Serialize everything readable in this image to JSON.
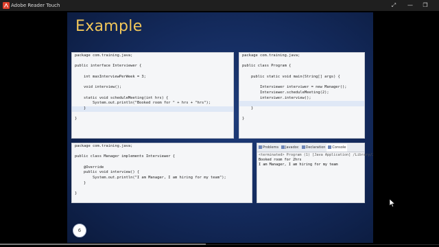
{
  "window": {
    "app_title": "Adobe Reader Touch",
    "icon": "adobe-reader-icon",
    "buttons": {
      "expand": "⤢",
      "minimize": "—",
      "restore": "❐",
      "close": "✕"
    }
  },
  "slide": {
    "title": "Example",
    "page_number": "6",
    "panels": {
      "interviewer": [
        "package com.training.java;",
        "",
        "public interface Interviewer {",
        "",
        "    int maxInterviewPerWeek = 3;",
        "",
        "    void interview();",
        "",
        "    static void scheduleMeeting(int hrs) {",
        "        System.out.println(\"Booked room for \" + hrs + \"hrs\");",
        "    }",
        "",
        "}"
      ],
      "program": [
        "package com.training.java;",
        "",
        "public class Program {",
        "",
        "    public static void main(String[] args) {",
        "",
        "        Interviewer interviwer = new Manager();",
        "        Interviewer.scheduleMeeting(2);",
        "        interviwer.interview();",
        "",
        "    }",
        "",
        "}"
      ],
      "manager": [
        "package com.training.java;",
        "",
        "public class Manager implements Interviewer {",
        "",
        "    @Override",
        "    public void interview() {",
        "        System.out.println(\"I am Manager, I am hiring for my team\");",
        "    }",
        "",
        "}"
      ],
      "console": {
        "tabs": [
          "Problems",
          "Javadoc",
          "Declaration",
          "Console"
        ],
        "active_tab": "Console",
        "lines": [
          "<terminated> Program (1) [Java Application] /Library/Java/Java",
          "Booked room for 2hrs",
          "I am Manager, I am hiring for my team"
        ]
      }
    }
  },
  "colors": {
    "title": "#f2c75a",
    "slide_bg": "#13295a",
    "keyword": "#7f0055",
    "string": "#2a00ff",
    "field": "#0000c0"
  }
}
